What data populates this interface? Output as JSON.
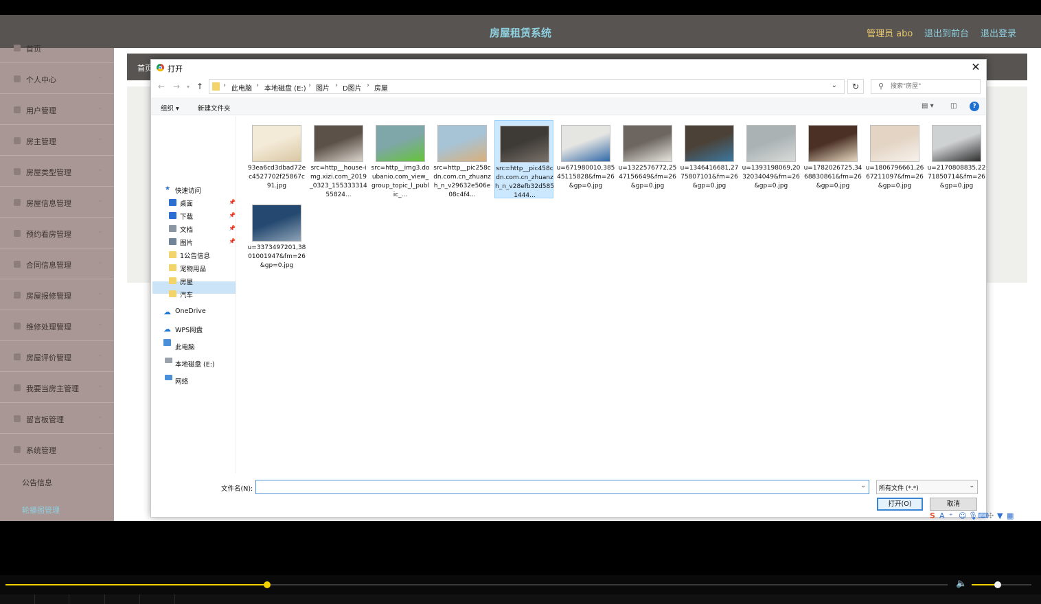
{
  "app": {
    "title": "房屋租赁系统",
    "admin_label": "管理员 abo",
    "links": [
      "退出到前台",
      "退出登录"
    ],
    "breadcrumb": "首页"
  },
  "sidebar": {
    "items": [
      "首页",
      "个人中心",
      "用户管理",
      "房主管理",
      "房屋类型管理",
      "房屋信息管理",
      "预约看房管理",
      "合同信息管理",
      "房屋报修管理",
      "维修处理管理",
      "房屋评价管理",
      "我要当房主管理",
      "留言板管理",
      "系统管理"
    ],
    "sub_items": [
      "公告信息",
      "轮播图管理"
    ],
    "active_sub": 1
  },
  "dialog": {
    "title": "打开",
    "close_glyph": "✕",
    "path": [
      "此电脑",
      "本地磁盘 (E:)",
      "图片",
      "D图片",
      "房屋"
    ],
    "search_placeholder": "搜索\"房屋\"",
    "toolbar": {
      "organize": "组织 ▾",
      "new_folder": "新建文件夹",
      "help": "?"
    },
    "nav": {
      "quick_access": "快速访问",
      "quick_items": [
        "桌面",
        "下载",
        "文档",
        "图片",
        "1公告信息",
        "宠物用品",
        "房屋",
        "汽车"
      ],
      "onedrive": "OneDrive",
      "wps": "WPS网盘",
      "this_pc": "此电脑",
      "local_disk": "本地磁盘 (E:)",
      "network": "网络"
    },
    "files": [
      {
        "name": "93ea6cd3dbad72ec4527702f25867c91.jpg",
        "colors": [
          "#f3ead7",
          "#d9c7a3"
        ]
      },
      {
        "name": "src=http__house-img.xizi.com_2019_0323_15533331455824...",
        "colors": [
          "#5c5148",
          "#d9d4cc"
        ]
      },
      {
        "name": "src=http__img3.doubanio.com_view_group_topic_l_public_...",
        "colors": [
          "#7fa6a9",
          "#65c33a"
        ]
      },
      {
        "name": "src=http__pic258cdn.com.cn_zhuanzh_n_v29632e506e08c4f4...",
        "colors": [
          "#a7c3d6",
          "#d9b07a"
        ]
      },
      {
        "name": "src=http__pic458cdn.com.cn_zhuanzh_n_v28efb32d5851444...",
        "colors": [
          "#3e3a36",
          "#7a726a"
        ],
        "selected": true
      },
      {
        "name": "u=671980010,38545115828&fm=26&gp=0.jpg",
        "colors": [
          "#e5e5e2",
          "#3169a8"
        ]
      },
      {
        "name": "u=1322576772,2547156649&fm=26&gp=0.jpg",
        "colors": [
          "#6d6660",
          "#e8e5df"
        ]
      },
      {
        "name": "u=1346416681,2775807101&fm=26&gp=0.jpg",
        "colors": [
          "#4b4137",
          "#3c78a0"
        ]
      },
      {
        "name": "u=1393198069,2032034049&fm=26&gp=0.jpg",
        "colors": [
          "#aab2b4",
          "#d9dcd8"
        ]
      },
      {
        "name": "u=1782026725,3468830861&fm=26&gp=0.jpg",
        "colors": [
          "#4a3025",
          "#e6d8c0"
        ]
      },
      {
        "name": "u=1806796661,2667211097&fm=26&gp=0.jpg",
        "colors": [
          "#e3d4c4",
          "#f7f2ec"
        ]
      },
      {
        "name": "u=2170808835,2271850714&fm=26&gp=0.jpg",
        "colors": [
          "#cfd2d3",
          "#2e2e2e"
        ]
      },
      {
        "name": "u=3373497201,3801001947&fm=26&gp=0.jpg",
        "colors": [
          "#24486f",
          "#8ea3b7"
        ]
      }
    ],
    "filename_label": "文件名(N):",
    "filename_value": "",
    "filetype": "所有文件 (*.*)",
    "open_button": "打开(O)",
    "cancel_button": "取消"
  },
  "player": {
    "progress": 0.278,
    "volume": 0.44
  },
  "colors": {
    "topbar": "#575451",
    "sidebar": "#a99795",
    "accent": "#8fd0e0",
    "admin": "#e8c86d",
    "seek": "#f2d300"
  }
}
